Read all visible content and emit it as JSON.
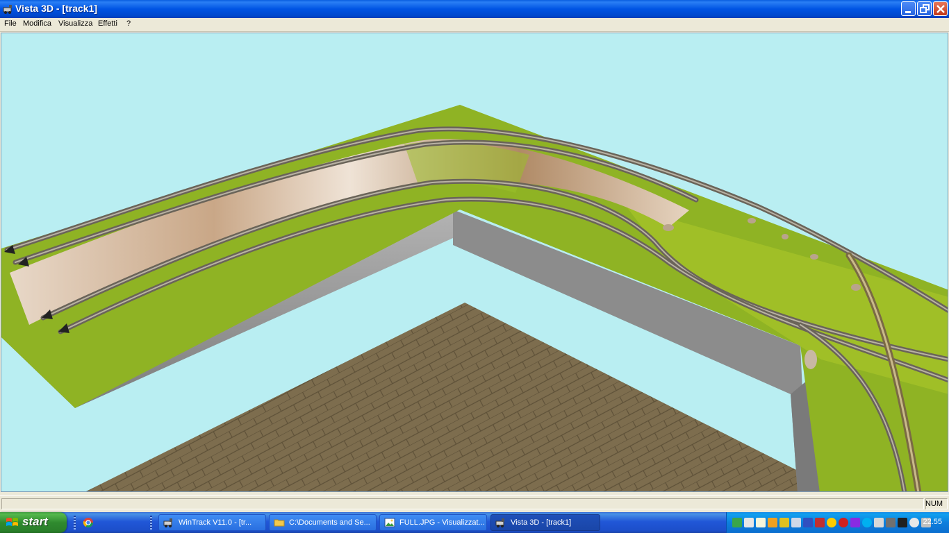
{
  "window": {
    "title": "Vista 3D - [track1]",
    "icon": "train-icon"
  },
  "menu": [
    "File",
    "Modifica",
    "Visualizza",
    "Effetti",
    "?"
  ],
  "statusbar": {
    "num": "NUM"
  },
  "taskbar": {
    "start_label": "start",
    "quick_launch": [
      "chrome-icon"
    ],
    "tasks": [
      {
        "label": "WinTrack  V11.0 - [tr...",
        "icon": "train-icon",
        "active": false
      },
      {
        "label": "C:\\Documents and Se...",
        "icon": "folder-icon",
        "active": false
      },
      {
        "label": "FULL.JPG - Visualizzat...",
        "icon": "image-viewer-icon",
        "active": false
      },
      {
        "label": "Vista 3D - [track1]",
        "icon": "train-icon",
        "active": true
      }
    ],
    "clock": "22.55"
  },
  "colors": {
    "sky": "#b9eef2",
    "grass": "#8fb324",
    "wall": "#9a9a9a",
    "floor": "#7d6d4e",
    "taskbar": "#245edb",
    "titlebar": "#0054e3"
  }
}
